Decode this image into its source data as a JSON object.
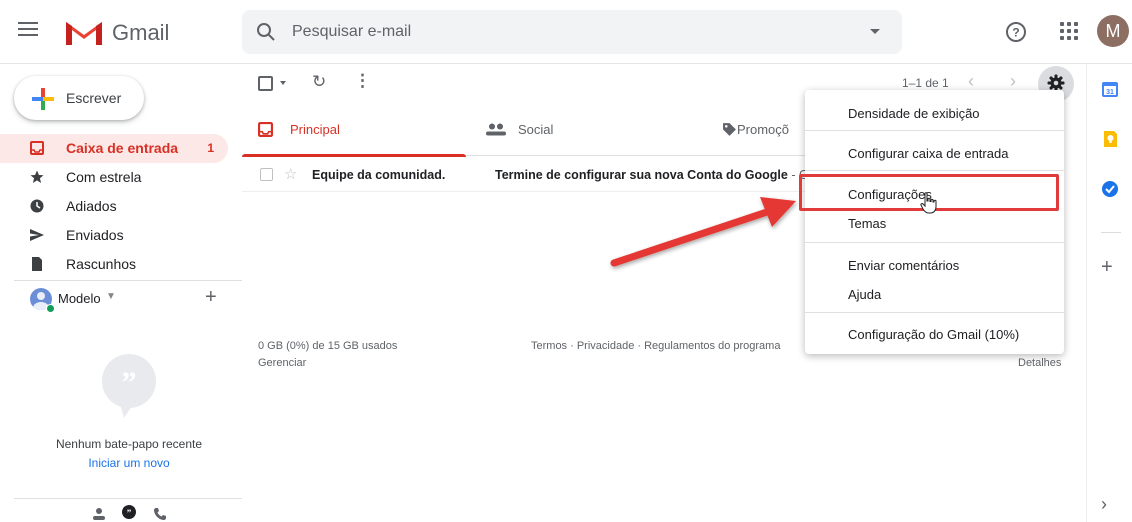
{
  "header": {
    "app_name": "Gmail",
    "search_placeholder": "Pesquisar e-mail",
    "avatar_initial": "M"
  },
  "compose": {
    "label": "Escrever"
  },
  "nav": [
    {
      "label": "Caixa de entrada",
      "count": "1",
      "icon": "inbox-icon",
      "active": true
    },
    {
      "label": "Com estrela",
      "count": "",
      "icon": "star-icon",
      "active": false
    },
    {
      "label": "Adiados",
      "count": "",
      "icon": "clock-icon",
      "active": false
    },
    {
      "label": "Enviados",
      "count": "",
      "icon": "send-icon",
      "active": false
    },
    {
      "label": "Rascunhos",
      "count": "",
      "icon": "draft-icon",
      "active": false
    }
  ],
  "chat": {
    "user": "Modelo",
    "empty_text": "Nenhum bate-papo recente",
    "start_link": "Iniciar um novo"
  },
  "toolbar": {
    "pager": "1–1 de 1"
  },
  "tabs": [
    {
      "label": "Principal",
      "icon": "inbox-icon",
      "active": true
    },
    {
      "label": "Social",
      "icon": "people-icon",
      "active": false
    },
    {
      "label": "Promoçõ",
      "icon": "tag-icon",
      "active": false
    }
  ],
  "emails": [
    {
      "sender": "Equipe da comunidad.",
      "subject": "Termine de configurar sua nova Conta do Google",
      "snippet": " - G"
    }
  ],
  "footer": {
    "storage": "0 GB (0%) de 15 GB usados",
    "manage": "Gerenciar",
    "terms": "Termos · Privacidade · Regulamentos do programa",
    "details": "Detalhes"
  },
  "menu": {
    "items": [
      "Densidade de exibição",
      "Configurar caixa de entrada",
      "Configurações",
      "Temas",
      "Enviar comentários",
      "Ajuda",
      "Configuração do Gmail (10%)"
    ]
  },
  "colors": {
    "accent_red": "#d93025",
    "link_blue": "#1a73e8",
    "annotation_red": "#e03a3a"
  }
}
